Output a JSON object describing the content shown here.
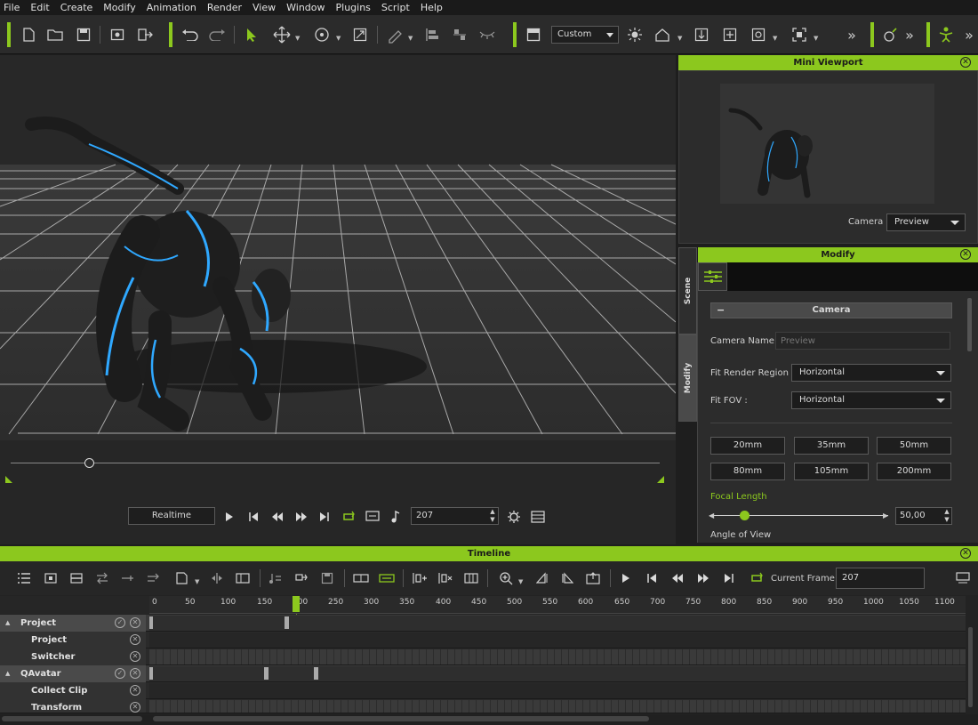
{
  "menu": [
    "File",
    "Edit",
    "Create",
    "Modify",
    "Animation",
    "Render",
    "View",
    "Window",
    "Plugins",
    "Script",
    "Help"
  ],
  "toolbar": {
    "view_mode": "Custom",
    "more": "»"
  },
  "mini_viewport": {
    "title": "Mini Viewport",
    "camera_label": "Camera",
    "camera_value": "Preview"
  },
  "modify": {
    "title": "Modify",
    "tabs": [
      "Scene",
      "Modify"
    ],
    "section": "Camera",
    "collapse": "−",
    "camera_name_label": "Camera Name :",
    "camera_name_placeholder": "Preview",
    "fit_render_region_label": "Fit Render Region :",
    "fit_render_region_value": "Horizontal",
    "fit_fov_label": "Fit FOV :",
    "fit_fov_value": "Horizontal",
    "lens_buttons": [
      "20mm",
      "35mm",
      "50mm",
      "80mm",
      "105mm",
      "200mm"
    ],
    "focal_length_label": "Focal Length",
    "focal_length_value": "50,00",
    "focal_length_slider": 0.17,
    "angle_of_view_label": "Angle of View"
  },
  "playback": {
    "mode": "Realtime",
    "frame": "207",
    "scrub_position": 0.12
  },
  "timeline": {
    "title": "Timeline",
    "current_frame_label": "Current Frame :",
    "current_frame": "207",
    "ruler_ticks": [
      "0",
      "50",
      "100",
      "150",
      "200",
      "250",
      "300",
      "350",
      "400",
      "450",
      "500",
      "550",
      "600",
      "650",
      "700",
      "750",
      "800",
      "850",
      "900",
      "950",
      "1000",
      "1050",
      "1100"
    ],
    "tracks": [
      {
        "label": "Project",
        "group": true
      },
      {
        "label": "Project",
        "group": false
      },
      {
        "label": "Switcher",
        "group": false
      },
      {
        "label": "QAvatar",
        "group": true
      },
      {
        "label": "Collect Clip",
        "group": false
      },
      {
        "label": "Transform",
        "group": false
      }
    ]
  },
  "colors": {
    "accent": "#8cc81e",
    "glow": "#2fa8ff"
  }
}
